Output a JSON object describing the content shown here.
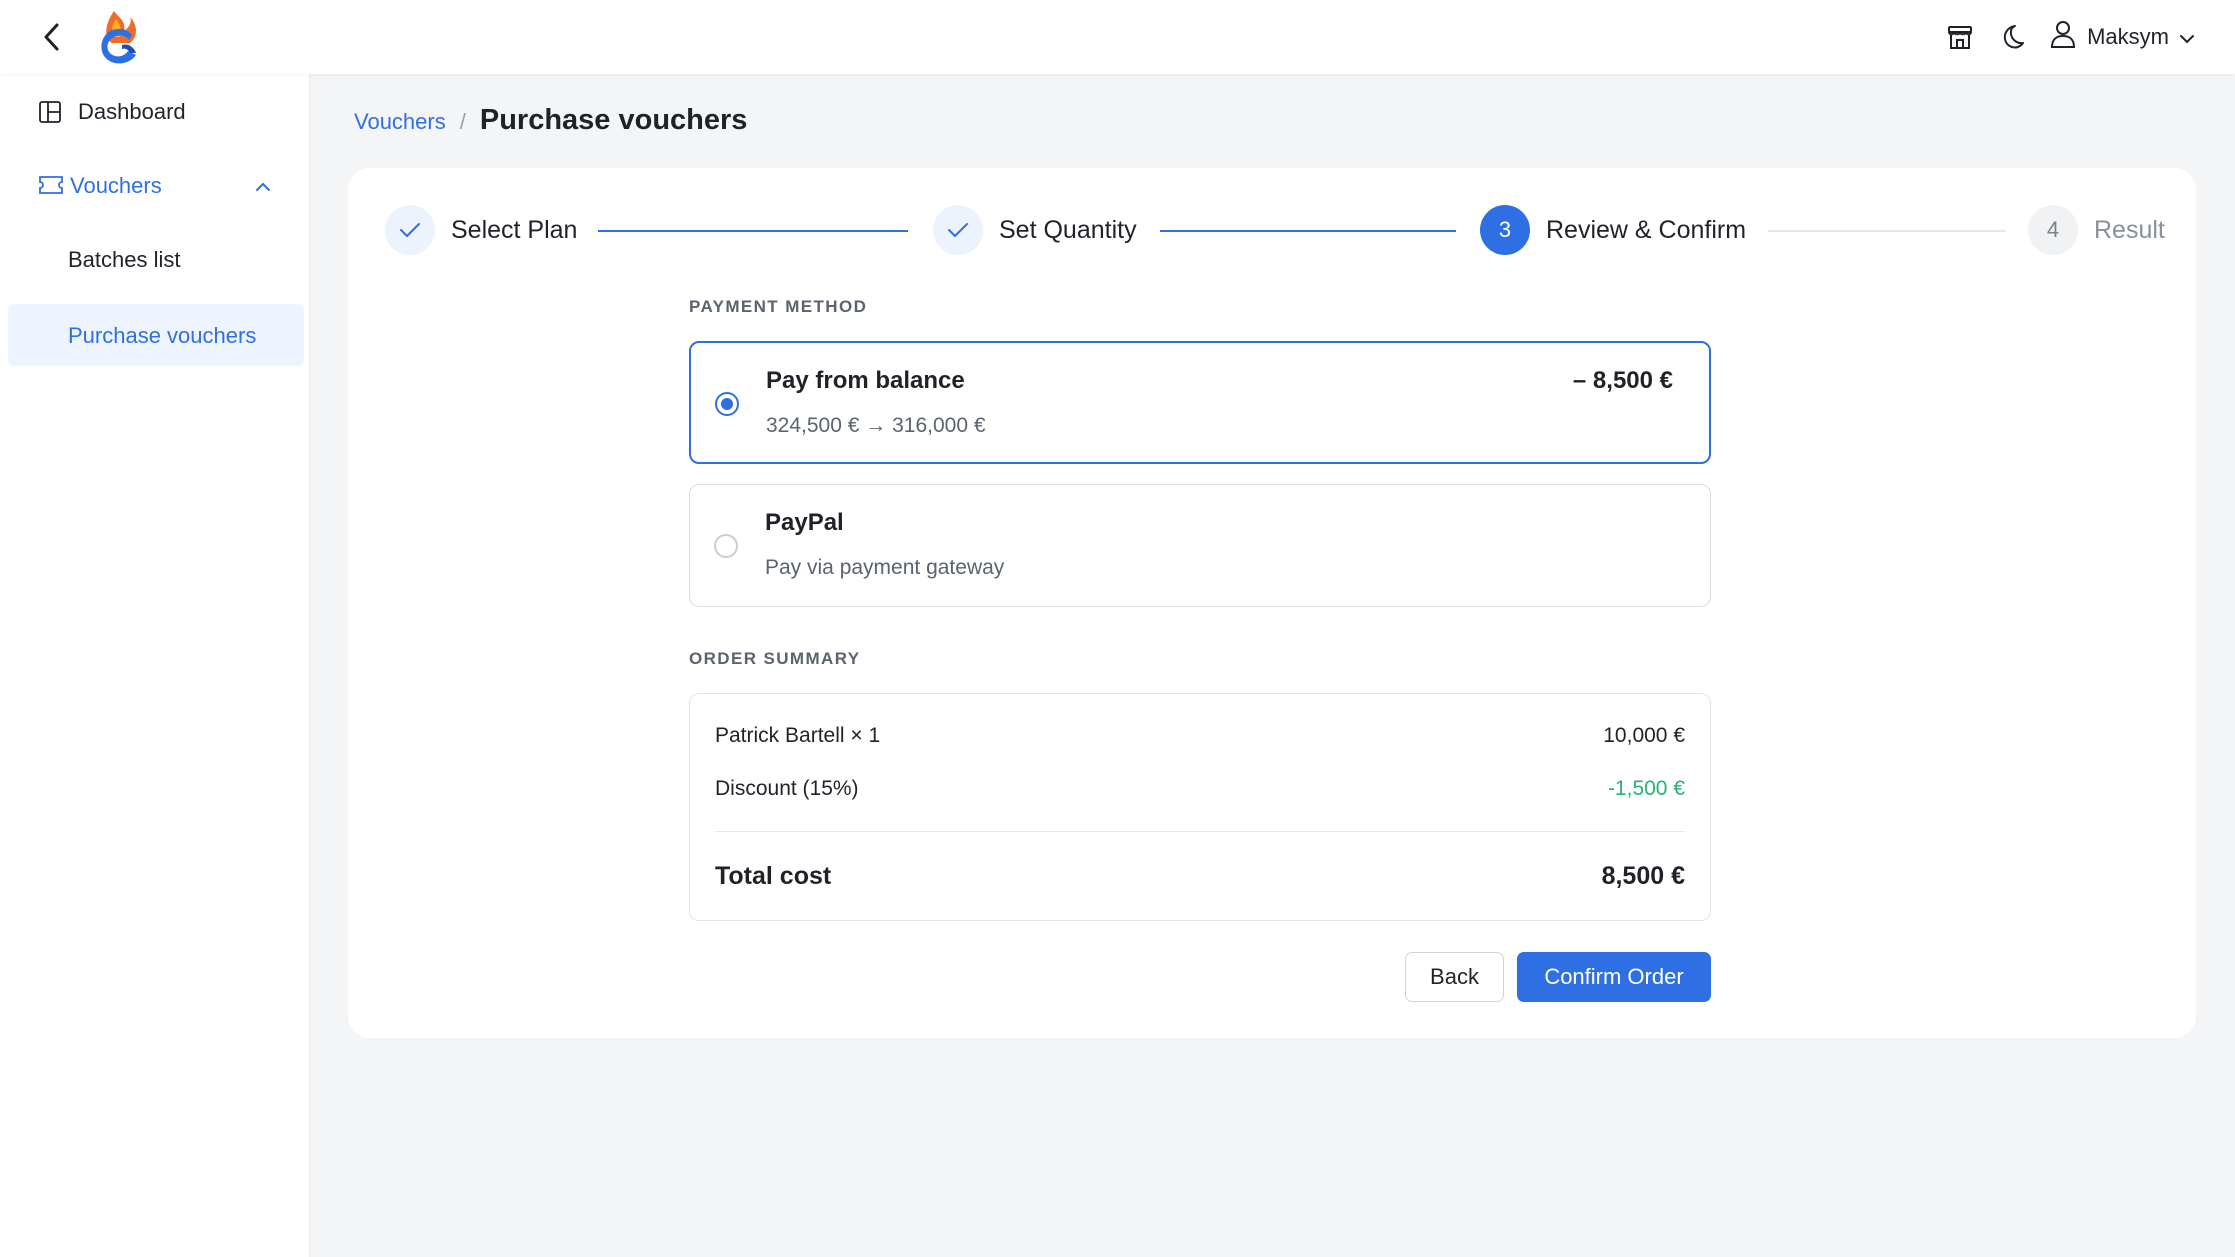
{
  "header": {
    "user_name": "Maksym",
    "icons": [
      "store-icon",
      "moon-icon",
      "user-icon",
      "chevron-down-icon"
    ],
    "brand_color": "#2f6fe4"
  },
  "sidebar": {
    "items": [
      {
        "label": "Dashboard",
        "icon": "dashboard-icon"
      },
      {
        "label": "Vouchers",
        "icon": "ticket-icon",
        "expanded": true
      },
      {
        "label": "Batches list"
      },
      {
        "label": "Purchase vouchers",
        "active": true
      }
    ]
  },
  "breadcrumb": {
    "parent": "Vouchers",
    "separator": "/",
    "current": "Purchase vouchers"
  },
  "stepper": {
    "steps": [
      {
        "label": "Select Plan",
        "state": "done"
      },
      {
        "label": "Set Quantity",
        "state": "done"
      },
      {
        "number": "3",
        "label": "Review & Confirm",
        "state": "current"
      },
      {
        "number": "4",
        "label": "Result",
        "state": "pending"
      }
    ]
  },
  "payment": {
    "title": "PAYMENT METHOD",
    "options": [
      {
        "title": "Pay from balance",
        "subtitle": "324,500 € → 316,000 €",
        "amount": "– 8,500 €",
        "selected": true
      },
      {
        "title": "PayPal",
        "subtitle": "Pay via payment gateway",
        "selected": false
      }
    ]
  },
  "summary": {
    "title": "ORDER SUMMARY",
    "rows": [
      {
        "label": "Patrick Bartell × 1",
        "value": "10,000 €"
      },
      {
        "label": "Discount (15%)",
        "value": "-1,500 €",
        "color": "#22b573"
      }
    ],
    "total_label": "Total cost",
    "total_value": "8,500 €"
  },
  "actions": {
    "back_label": "Back",
    "confirm_label": "Confirm Order"
  }
}
